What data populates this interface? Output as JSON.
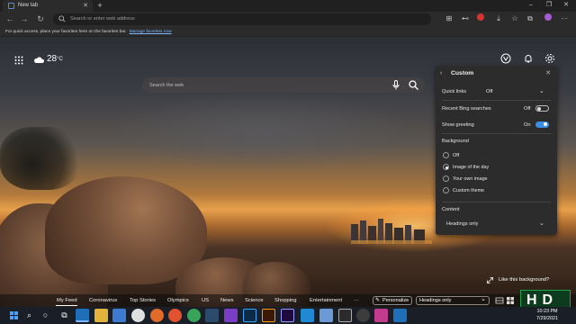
{
  "browser": {
    "tab_title": "New tab",
    "new_tab_glyph": "+",
    "address_placeholder": "Search or enter web address",
    "favorites_bar": {
      "text": "For quick access, place your favorites here on the favorites bar.",
      "link": "Manage favorites now"
    },
    "window_controls": [
      "–",
      "❐",
      "✕"
    ],
    "toolbar_icons": [
      "read-aloud-icon",
      "extensions-icon",
      "adblock-icon",
      "collections-icon",
      "favorites-icon",
      "tab-actions-icon",
      "profile-icon",
      "more-icon"
    ]
  },
  "weather": {
    "temp": "28",
    "unit": "°C",
    "icon": "partly-cloudy-icon"
  },
  "search": {
    "placeholder": "Search the web"
  },
  "panel": {
    "title": "Custom",
    "quick_links": {
      "label": "Quick links",
      "value": "Off"
    },
    "bing": {
      "label": "Recent Bing searches",
      "value": "Off",
      "on": false
    },
    "greeting": {
      "label": "Show greeting",
      "value": "On",
      "on": true
    },
    "background": {
      "heading": "Background",
      "options": [
        "Off",
        "Image of the day",
        "Your own image",
        "Custom theme"
      ],
      "selected_index": 1
    },
    "content": {
      "heading": "Content",
      "value": "Headings only"
    }
  },
  "like_background": "Like this background?",
  "feed": {
    "items": [
      "My Feed",
      "Coronavirus",
      "Top Stories",
      "Olympics",
      "US",
      "News",
      "Science",
      "Shopping",
      "Entertainment",
      "···"
    ],
    "active_index": 0,
    "personalize": "Personalize",
    "layout_select": "Headings only"
  },
  "taskbar": {
    "apps": [
      "start-icon",
      "search-icon",
      "task-view-icon",
      "edge-icon",
      "file-explorer-icon",
      "store-icon",
      "chrome-icon",
      "firefox-icon",
      "android-icon",
      "steam-icon",
      "visual-studio-icon",
      "photoshop-icon",
      "illustrator-icon",
      "premiere-icon",
      "vscode-icon",
      "app-icon",
      "unity-icon",
      "obs-icon",
      "media-icon",
      "news-icon"
    ],
    "time": "10:23 PM",
    "date": "7/29/2021"
  },
  "logo_text": "HD",
  "colors": {
    "accent": "#3a8ee6",
    "panel_bg": "#2c2c2c",
    "taskbar_bg": "#1a1f27"
  }
}
